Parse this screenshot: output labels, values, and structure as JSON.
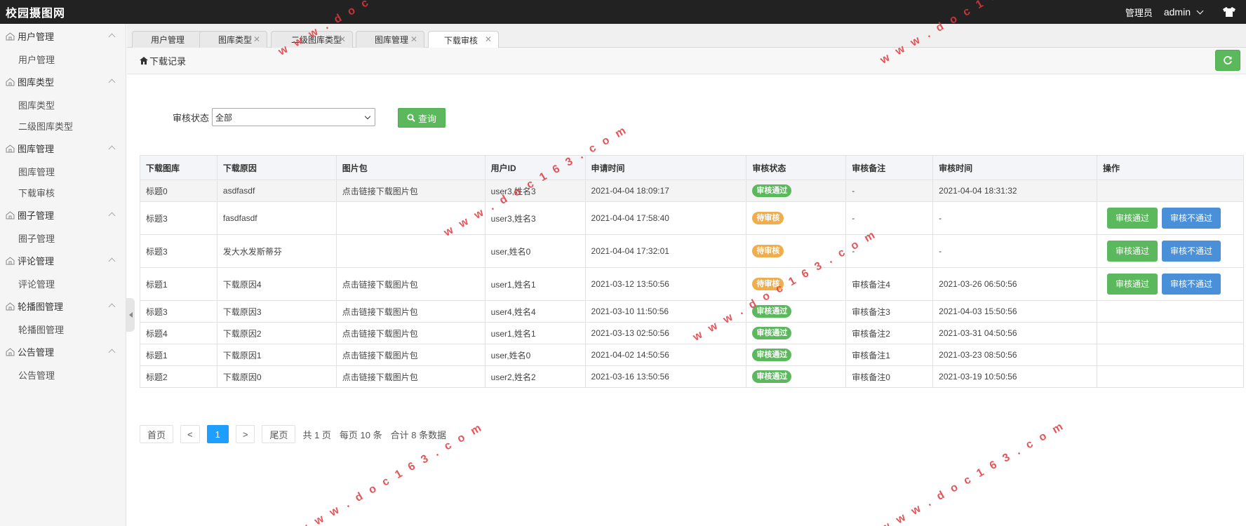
{
  "app": {
    "title": "校园摄图网"
  },
  "header": {
    "role": "管理员",
    "user": "admin"
  },
  "sidebar": {
    "groups": [
      {
        "label": "用户管理",
        "items": [
          "用户管理"
        ]
      },
      {
        "label": "图库类型",
        "items": [
          "图库类型",
          "二级图库类型"
        ]
      },
      {
        "label": "图库管理",
        "items": [
          "图库管理",
          "下载审核"
        ]
      },
      {
        "label": "圈子管理",
        "items": [
          "圈子管理"
        ]
      },
      {
        "label": "评论管理",
        "items": [
          "评论管理"
        ]
      },
      {
        "label": "轮播图管理",
        "items": [
          "轮播图管理"
        ]
      },
      {
        "label": "公告管理",
        "items": [
          "公告管理"
        ]
      }
    ]
  },
  "tabs": [
    "用户管理",
    "图库类型",
    "二级图库类型",
    "图库管理",
    "下载审核"
  ],
  "breadcrumb": "下载记录",
  "search": {
    "label": "审核状态",
    "selected": "全部",
    "button": "查询"
  },
  "table": {
    "columns": [
      "下载图库",
      "下载原因",
      "图片包",
      "用户ID",
      "申请时间",
      "审核状态",
      "审核备注",
      "审核时间",
      "操作"
    ],
    "rows": [
      [
        "标题0",
        "asdfasdf",
        "点击链接下载图片包",
        "user3,姓名3",
        "2021-04-04 18:09:17",
        "审核通过",
        "-",
        "2021-04-04 18:31:32"
      ],
      [
        "标题3",
        "fasdfasdf",
        "",
        "user3,姓名3",
        "2021-04-04 17:58:40",
        "待审核",
        "-",
        "-"
      ],
      [
        "标题3",
        "发大水发斯蒂芬",
        "",
        "user,姓名0",
        "2021-04-04 17:32:01",
        "待审核",
        "-",
        "-"
      ],
      [
        "标题1",
        "下载原因4",
        "点击链接下载图片包",
        "user1,姓名1",
        "2021-03-12 13:50:56",
        "待审核",
        "审核备注4",
        "2021-03-26 06:50:56"
      ],
      [
        "标题3",
        "下载原因3",
        "点击链接下载图片包",
        "user4,姓名4",
        "2021-03-10 11:50:56",
        "审核通过",
        "审核备注3",
        "2021-04-03 15:50:56"
      ],
      [
        "标题4",
        "下载原因2",
        "点击链接下载图片包",
        "user1,姓名1",
        "2021-03-13 02:50:56",
        "审核通过",
        "审核备注2",
        "2021-03-31 04:50:56"
      ],
      [
        "标题1",
        "下载原因1",
        "点击链接下载图片包",
        "user,姓名0",
        "2021-04-02 14:50:56",
        "审核通过",
        "审核备注1",
        "2021-03-23 08:50:56"
      ],
      [
        "标题2",
        "下载原因0",
        "点击链接下载图片包",
        "user2,姓名2",
        "2021-03-16 13:50:56",
        "审核通过",
        "审核备注0",
        "2021-03-19 10:50:56"
      ]
    ],
    "actions": {
      "approve": "审核通过",
      "reject": "审核不通过"
    }
  },
  "pager": {
    "first": "首页",
    "prev": "<",
    "current": "1",
    "next": ">",
    "last": "尾页",
    "total_pages": "共 1 页",
    "per_page": "每页 10 条",
    "total_records": "合计 8 条数据"
  },
  "watermark": "w w w . d o c 1 6 3 . c o m",
  "colors": {
    "success": "#5cb85c",
    "warning": "#f0ad4e",
    "primary": "#4a90d9",
    "current_page": "#1e9fff",
    "topbar": "#222222"
  }
}
